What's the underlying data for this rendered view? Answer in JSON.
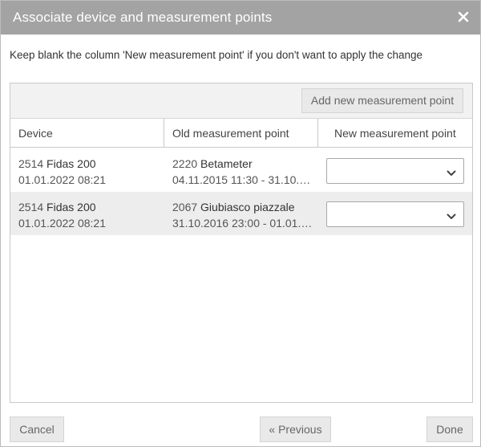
{
  "dialog": {
    "title": "Associate device and measurement points",
    "instruction": "Keep blank the column 'New measurement point' if you don't want to apply the change"
  },
  "toolbar": {
    "add_label": "Add new measurement point"
  },
  "table": {
    "columns": [
      "Device",
      "Old measurement point",
      "New measurement point"
    ],
    "rows": [
      {
        "device_id": "2514",
        "device_name": "Fidas 200",
        "device_date": "01.01.2022 08:21",
        "old_id": "2220",
        "old_name": "Betameter",
        "old_period": "04.11.2015 11:30 - 31.10.2…",
        "new_value": ""
      },
      {
        "device_id": "2514",
        "device_name": "Fidas 200",
        "device_date": "01.01.2022 08:21",
        "old_id": "2067",
        "old_name": "Giubiasco piazzale",
        "old_period": "31.10.2016 23:00 - 01.01.2…",
        "new_value": ""
      }
    ]
  },
  "footer": {
    "cancel_label": "Cancel",
    "previous_label": "« Previous",
    "done_label": "Done"
  },
  "icons": {
    "close": "close-icon",
    "dropdown": "chevron-down-icon"
  },
  "colors": {
    "titlebar": "#a3a3a3",
    "row_alt": "#ededed",
    "button_bg": "#e9e9e9"
  }
}
